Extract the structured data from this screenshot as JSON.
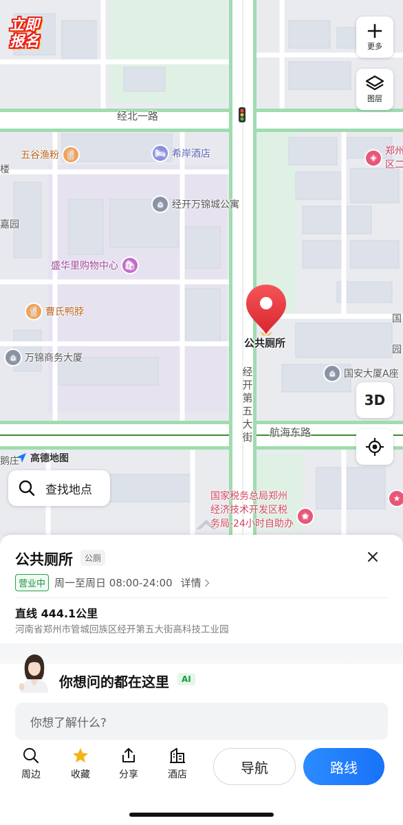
{
  "map": {
    "promo_label": "立即报名",
    "buttons": {
      "more_label": "更多",
      "layers_label": "图层",
      "three_d_label": "3D"
    },
    "brand_label": "高德地图",
    "search_label": "查找地点",
    "roads": {
      "north_road": "经北一路",
      "east_road": "航海东路",
      "avenue": [
        "经",
        "开",
        "第",
        "五",
        "大",
        "街"
      ]
    },
    "pois": {
      "wugu": "五谷渔粉",
      "xian_hotel": "希岸酒店",
      "wanjin_apartment": "经开万锦城公寓",
      "shenghua_mall": "盛华里购物中心",
      "caoshi": "曹氏鸭脖",
      "wanjin_tower": "万锦商务大厦",
      "guoan_tower": "国安大厦A座",
      "tax_bureau": [
        "国家税务总局郑州",
        "经济技术开发区税",
        "务局-24小时自助办"
      ],
      "edge_left_1": "楼",
      "edge_left_2": "嘉园",
      "edge_right_1": "郑州",
      "edge_right_2": "区二",
      "edge_right_3": "国",
      "edge_right_4": "园",
      "edge_bottom_left": "鹅庄"
    },
    "selected_marker_label": "公共厕所"
  },
  "place": {
    "name": "公共厕所",
    "type": "公厕",
    "status": "营业中",
    "hours": "周一至周日 08:00-24:00",
    "detail_label": "详情",
    "distance": "直线 444.1公里",
    "address": "河南省郑州市管城回族区经开第五大街高科技工业园"
  },
  "ai": {
    "title": "你想问的都在这里",
    "badge": "AI",
    "input_placeholder": "你想了解什么?"
  },
  "actions": {
    "nearby": "周边",
    "favorite": "收藏",
    "share": "分享",
    "hotel": "酒店",
    "navigate": "导航",
    "route": "路线"
  },
  "colors": {
    "accent_blue": "#1873f7",
    "open_green": "#1e9443",
    "marker_red": "#e8323a",
    "road_green": "#9fdcb0"
  }
}
